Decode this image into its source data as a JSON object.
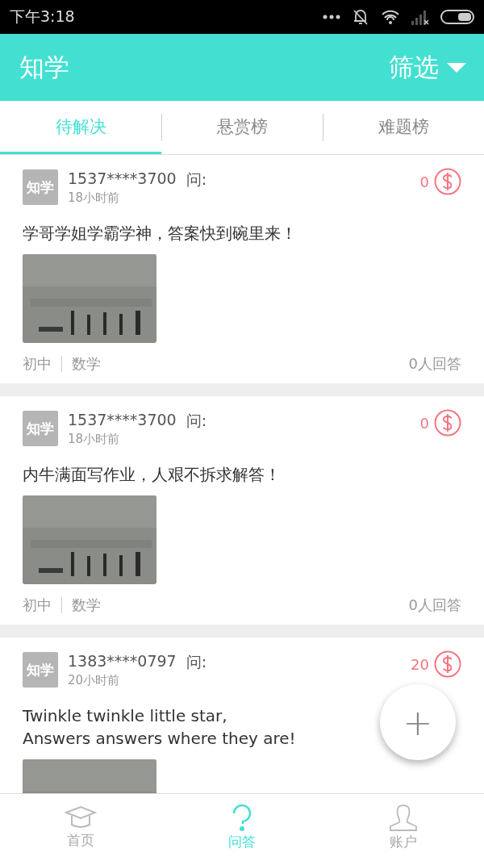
{
  "status_bar": {
    "time": "下午3:18"
  },
  "header": {
    "title": "知学",
    "filter": "筛选"
  },
  "tabs": [
    {
      "label": "待解决",
      "selected": true
    },
    {
      "label": "悬赏榜",
      "selected": false
    },
    {
      "label": "难题榜",
      "selected": false
    }
  ],
  "questions": [
    {
      "avatar": "知学",
      "user": "1537****3700",
      "ask": "问:",
      "time": "18小时前",
      "reward": "0",
      "text": "学哥学姐学霸学神，答案快到碗里来！",
      "level": "初中",
      "subject": "数学",
      "answers": "0人回答"
    },
    {
      "avatar": "知学",
      "user": "1537****3700",
      "ask": "问:",
      "time": "18小时前",
      "reward": "0",
      "text": "内牛满面写作业，人艰不拆求解答！",
      "level": "初中",
      "subject": "数学",
      "answers": "0人回答"
    },
    {
      "avatar": "知学",
      "user": "1383****0797",
      "ask": "问:",
      "time": "20小时前",
      "reward": "20",
      "text": "Twinkle twinkle little star,\nAnswers answers where they are!"
    }
  ],
  "fab": {
    "label": "+"
  },
  "bottom_nav": [
    {
      "label": "首页",
      "selected": false,
      "kind": "home"
    },
    {
      "label": "问答",
      "selected": true,
      "kind": "qa"
    },
    {
      "label": "账户",
      "selected": false,
      "kind": "account"
    }
  ]
}
